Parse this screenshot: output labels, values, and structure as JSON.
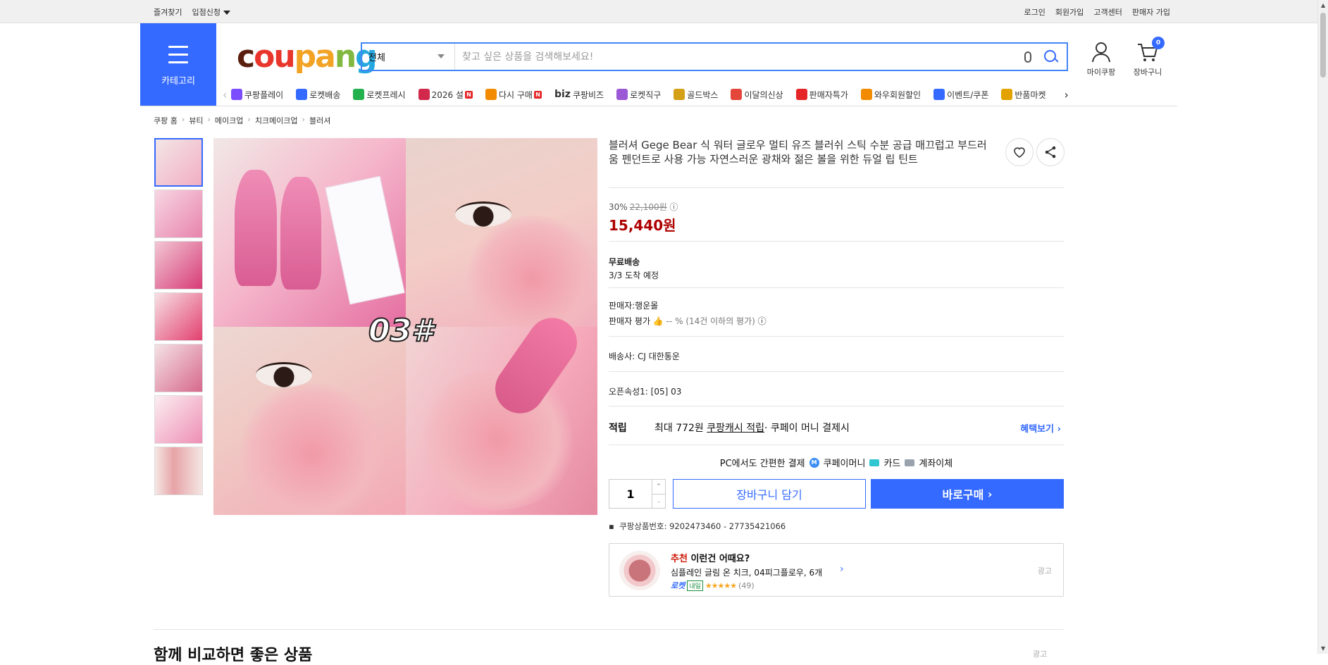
{
  "topbar": {
    "left": [
      "즐겨찾기",
      "입점신청"
    ],
    "right": [
      "로그인",
      "회원가입",
      "고객센터",
      "판매자 가입"
    ]
  },
  "header": {
    "category_label": "카테고리",
    "logo_text": [
      "c",
      "ou",
      "pa",
      "n",
      "g"
    ],
    "search": {
      "category": "전체",
      "placeholder": "찾고 싶은 상품을 검색해보세요!"
    },
    "mypage_label": "마이쿠팡",
    "cart_label": "장바구니",
    "cart_count": "0"
  },
  "gnb": [
    {
      "label": "쿠팡플레이",
      "color": "#7b4dff"
    },
    {
      "label": "로켓배송",
      "color": "#346aff"
    },
    {
      "label": "로켓프레시",
      "color": "#22b14c"
    },
    {
      "label": "2026 설",
      "color": "#d1284c",
      "new": "N"
    },
    {
      "label": "다시 구매",
      "color": "#f28b00",
      "new": "N"
    },
    {
      "label": "쿠팡비즈",
      "color": "#333333",
      "prefix": "biz"
    },
    {
      "label": "로켓직구",
      "color": "#9b59d6"
    },
    {
      "label": "골드박스",
      "color": "#d4a017"
    },
    {
      "label": "이달의신상",
      "color": "#e5463a"
    },
    {
      "label": "판매자특가",
      "color": "#e52528"
    },
    {
      "label": "와우회원할인",
      "color": "#f28b00"
    },
    {
      "label": "이벤트/쿠폰",
      "color": "#346aff"
    },
    {
      "label": "반품마켓",
      "color": "#e2a200"
    }
  ],
  "breadcrumb": [
    "쿠팡 홈",
    "뷰티",
    "메이크업",
    "치크메이크업",
    "블러셔"
  ],
  "product": {
    "title": "블러셔 Gege Bear 식 워터 글로우 멀티 유즈 블러쉬 스틱 수분 공급 매끄럽고 부드러움 펜던트로 사용 가능 자연스러운 광채와 젊은 볼을 위한 듀얼 립 틴트",
    "image_label": "03#",
    "discount_rate": "30%",
    "original_price": "22,100원",
    "price": "15,440원",
    "shipping_title": "무료배송",
    "shipping_eta": "3/3 도착 예정",
    "seller": "판매자:행운몰",
    "seller_rating_label": "판매자 평가",
    "seller_rating_value": "-- % (14건 이하의 평가)",
    "courier": "배송사:  CJ 대한통운",
    "option": "오픈속성1: [05] 03",
    "reward_key": "적립",
    "reward_text": "최대 772원",
    "reward_link": "쿠팡캐시 적립",
    "reward_suffix": " · 쿠페이 머니 결제시",
    "reward_more": "혜택보기",
    "pay_label": "PC에서도 간편한 결제",
    "pay_methods": [
      "쿠페이머니",
      "카드",
      "계좌이체"
    ],
    "quantity": "1",
    "add_cart_label": "장바구니 담기",
    "buy_now_label": "바로구매",
    "product_id": "쿠팡상품번호: 9202473460 - 27735421066"
  },
  "recommend": {
    "prefix": "추천",
    "title": " 이런건 어때요?",
    "item": "심플레인 글림 온 치크, 04피그플로우, 6개",
    "rocket": "로켓",
    "tag": "내일",
    "stars": "★★★★★",
    "rating": 4.5,
    "count": "(49)",
    "ad": "광고"
  },
  "bottom": {
    "title": "함께 비교하면 좋은 상품",
    "ad": "광고"
  }
}
